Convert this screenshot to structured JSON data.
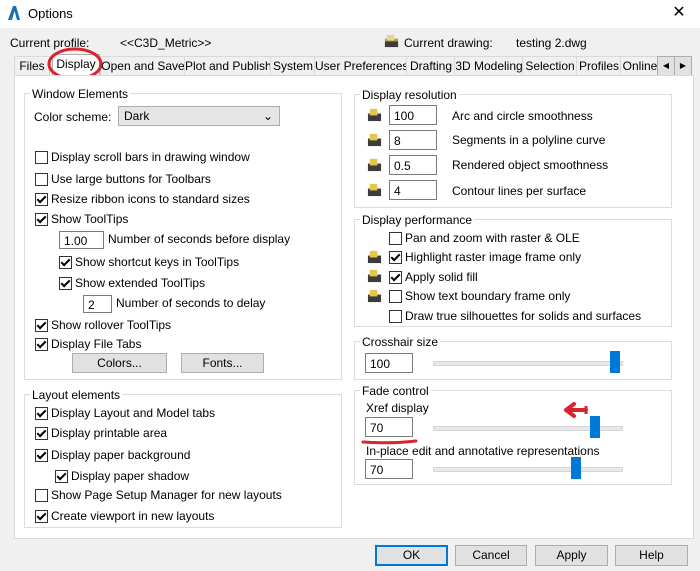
{
  "window": {
    "title": "Options",
    "close": "✕"
  },
  "header": {
    "profile_label": "Current profile:",
    "profile_value": "<<C3D_Metric>>",
    "drawing_label": "Current drawing:",
    "drawing_value": "testing 2.dwg"
  },
  "tabs": [
    "Files",
    "Display",
    "Open and Save",
    "Plot and Publish",
    "System",
    "User Preferences",
    "Drafting",
    "3D Modeling",
    "Selection",
    "Profiles",
    "Online"
  ],
  "active_tab": "Display",
  "window_elements": {
    "title": "Window Elements",
    "color_scheme_label": "Color scheme:",
    "color_scheme_value": "Dark",
    "items": [
      {
        "label": "Display scroll bars in drawing window",
        "checked": false
      },
      {
        "label": "Use large buttons for Toolbars",
        "checked": false
      },
      {
        "label": "Resize ribbon icons to standard sizes",
        "checked": true
      },
      {
        "label": "Show ToolTips",
        "checked": true
      }
    ],
    "tooltip_seconds_value": "1.00",
    "tooltip_seconds_label": "Number of seconds before display",
    "shortcut_keys_label": "Show shortcut keys in ToolTips",
    "extended_tooltips_label": "Show extended ToolTips",
    "delay_value": "2",
    "delay_label": "Number of seconds to delay",
    "rollover_label": "Show rollover ToolTips",
    "file_tabs_label": "Display File Tabs",
    "colors_button": "Colors...",
    "fonts_button": "Fonts..."
  },
  "layout_elements": {
    "title": "Layout elements",
    "layout_model_tabs": "Display Layout and Model tabs",
    "printable_area": "Display printable area",
    "paper_background": "Display paper background",
    "paper_shadow": "Display paper shadow",
    "page_setup_manager": "Show Page Setup Manager for new layouts",
    "create_viewport": "Create viewport in new layouts"
  },
  "display_resolution": {
    "title": "Display resolution",
    "rows": [
      {
        "value": "100",
        "label": "Arc and circle smoothness"
      },
      {
        "value": "8",
        "label": "Segments in a polyline curve"
      },
      {
        "value": "0.5",
        "label": "Rendered object smoothness"
      },
      {
        "value": "4",
        "label": "Contour lines per surface"
      }
    ]
  },
  "display_performance": {
    "title": "Display performance",
    "pan_zoom": "Pan and zoom with raster & OLE",
    "highlight_raster": "Highlight raster image frame only",
    "apply_solid_fill": "Apply solid fill",
    "text_boundary": "Show text boundary frame only",
    "silhouettes": "Draw true silhouettes for solids and surfaces"
  },
  "crosshair": {
    "title": "Crosshair size",
    "value": "100",
    "slider_fraction": 1.0
  },
  "fade_control": {
    "title": "Fade control",
    "xref_label": "Xref display",
    "xref_value": "70",
    "xref_fraction": 0.7,
    "inplace_label": "In-place edit and annotative representations",
    "inplace_value": "70",
    "inplace_fraction": 0.7
  },
  "footer": {
    "ok": "OK",
    "cancel": "Cancel",
    "apply": "Apply",
    "help": "Help"
  },
  "annotations": {
    "circle_color": "#d9232e",
    "arrow_color": "#d9232e"
  },
  "colors": {
    "accent": "#0078d7"
  }
}
